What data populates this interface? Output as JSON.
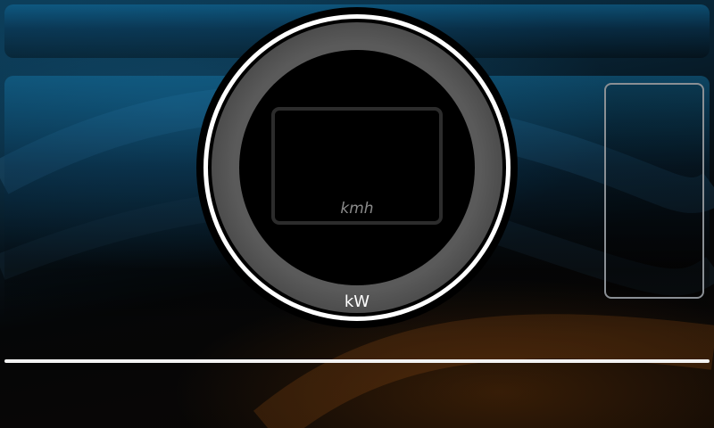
{
  "cluster": {
    "speed_unit": "kmh",
    "power_unit": "kW"
  },
  "colors": {
    "ring": "#ffffff",
    "bezel": "#5a5a5a",
    "divider": "#f2f2f2",
    "side_indicator_border": "#8a8f94"
  },
  "icons": []
}
